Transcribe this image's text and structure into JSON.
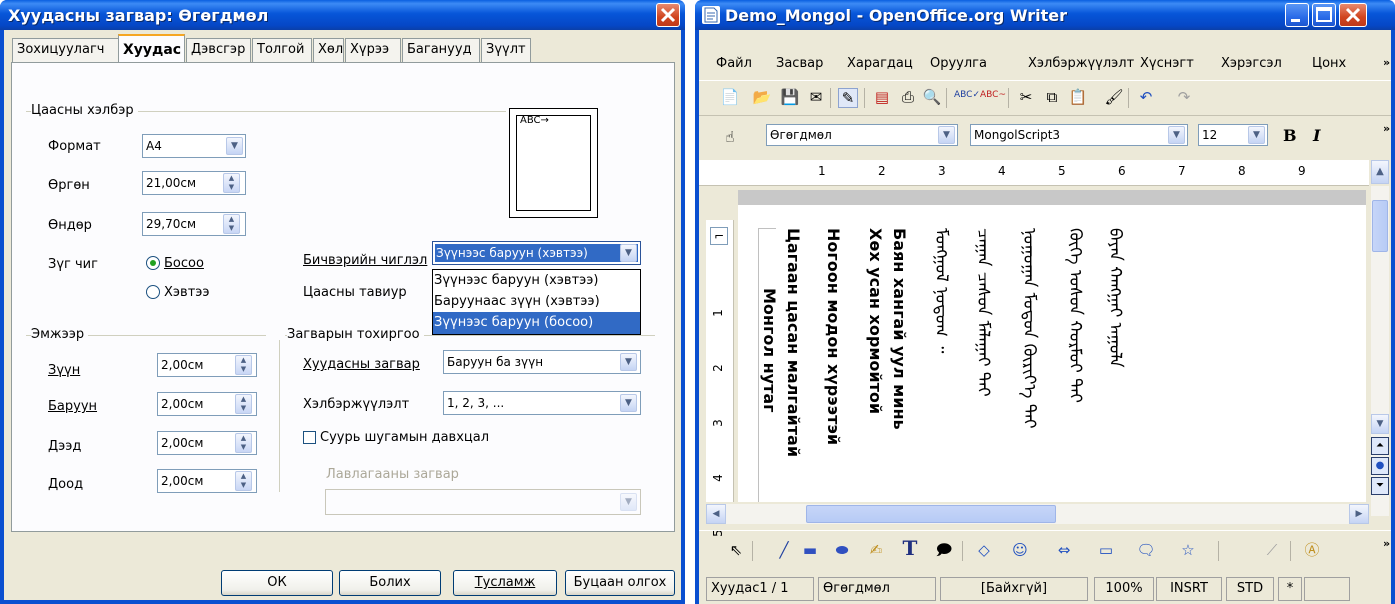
{
  "dialog": {
    "title": "Хуудасны загвар: Өгөгдмөл",
    "tabs": [
      "Зохицуулагч",
      "Хуудас",
      "Дэвсгэр",
      "Толгой",
      "Хөл",
      "Хүрээ",
      "Баганууд",
      "Зүүлт"
    ],
    "paper_format": {
      "section": "Цаасны хэлбэр",
      "format_label": "Формат",
      "format_value": "A4",
      "width_label": "Өргөн",
      "width_value": "21,00см",
      "height_label": "Өндөр",
      "height_value": "29,70см",
      "orientation_label": "Зүг чиг",
      "portrait_label": "Босоо",
      "landscape_label": "Хэвтээ",
      "text_direction_label": "Бичвэрийн чиглэл",
      "text_direction_value": "Зүүнээс баруун (хэвтээ)",
      "text_direction_options": [
        "Зүүнээс баруун (хэвтээ)",
        "Баруунаас зүүн (хэвтээ)",
        "Зүүнээс баруун (босоо)"
      ],
      "paper_tray_label": "Цаасны тавиур",
      "preview_text": "ABC→"
    },
    "margins": {
      "section": "Эмжээр",
      "left_label": "Зүүн",
      "left_value": "2,00см",
      "right_label": "Баруун",
      "right_value": "2,00см",
      "top_label": "Дээд",
      "top_value": "2,00см",
      "bottom_label": "Доод",
      "bottom_value": "2,00см"
    },
    "layout": {
      "section": "Загварын тохиргоо",
      "page_layout_label": "Хуудасны загвар",
      "page_layout_value": "Баруун ба зүүн",
      "format_label": "Хэлбэржүүлэлт",
      "format_value": "1, 2, 3, ...",
      "register_label": "Суурь шугамын давхцал",
      "ref_style_label": "Лавлагааны загвар"
    },
    "buttons": {
      "ok": "ОК",
      "cancel": "Болих",
      "help": "Тусламж",
      "reset": "Буцаан олгох"
    }
  },
  "writer": {
    "title": "Demo_Mongol - OpenOffice.org Writer",
    "menu": [
      "Файл",
      "Засвар",
      "Харагдац",
      "Оруулга",
      "Хэлбэржүүлэлт",
      "Хүснэгт",
      "Хэрэгсэл",
      "Цонх"
    ],
    "style_value": "Өгөгдмөл",
    "font_value": "MongolScript3",
    "size_value": "12",
    "bold": "B",
    "italic": "I",
    "ruler_numbers": [
      "1",
      "2",
      "3",
      "4",
      "5",
      "6",
      "7",
      "8",
      "9"
    ],
    "vruler_numbers": [
      "1",
      "2",
      "3",
      "4",
      "5"
    ],
    "doc_lines": [
      "Баян хангай уул минь",
      "Хөх усан хормойтой",
      "Ногоон модон хүрээтэй",
      "Цагаан цасан малгайтай",
      "Монгол нутаг"
    ],
    "mongol_cols": [
      "ᠪᠠᠶᠠᠨ ᠬᠠᠩᠭᠠᠢ ᠠᠭᠤᠯᠠ",
      "ᠬᠥᠬᠡ ᠤᠰᠤᠨ ᠬᠣᠷᠮᠣᠢ ᠲᠠᠢ",
      "ᠨᠣᠭᠣᠭᠠᠨ ᠮᠣᠳᠣᠨ ᠬᠦᠷᠢᠶ᠎ᠡ ᠲᠡᠢ",
      "ᠴᠠᠭᠠᠨ ᠴᠠᠰᠤᠨ ᠮᠠᠯᠠᠭᠠᠢ ᠲᠠᠢ",
      "ᠮᠣᠩᠭᠣᠯ ᠨᠤᠲᠤᠭ ᠃"
    ],
    "status": {
      "page": "Хуудас1 / 1",
      "style": "Өгөгдмөл",
      "lang": "[Байхгүй]",
      "zoom": "100%",
      "mode": "INSRT",
      "sel": "STD",
      "mod": "*"
    }
  }
}
